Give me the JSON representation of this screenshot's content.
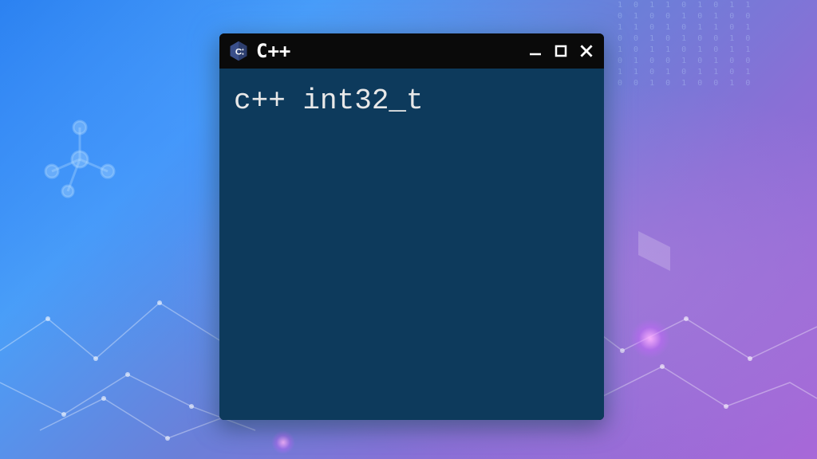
{
  "window": {
    "title": "C++",
    "icon_label": "C++"
  },
  "content": {
    "code": "c++ int32_t"
  },
  "colors": {
    "window_bg": "#0d3a5c",
    "titlebar_bg": "#0a0a0a",
    "text": "#e8e8e8"
  }
}
